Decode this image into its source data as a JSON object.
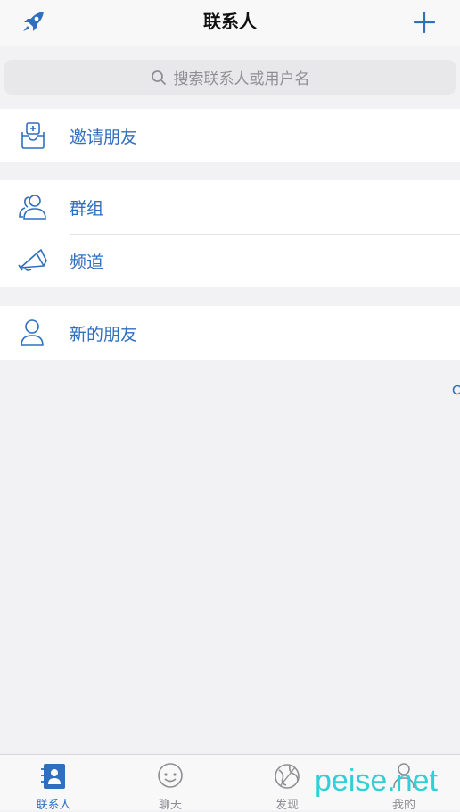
{
  "header": {
    "title": "联系人",
    "left_icon": "rocket-icon",
    "right_icon": "plus-icon"
  },
  "search": {
    "placeholder": "搜索联系人或用户名"
  },
  "sections": [
    {
      "items": [
        {
          "label": "邀请朋友",
          "icon": "invite-tray-icon"
        }
      ]
    },
    {
      "items": [
        {
          "label": "群组",
          "icon": "group-icon"
        },
        {
          "label": "频道",
          "icon": "megaphone-icon"
        }
      ]
    },
    {
      "items": [
        {
          "label": "新的朋友",
          "icon": "person-icon"
        }
      ]
    }
  ],
  "tabbar": {
    "tabs": [
      {
        "label": "联系人",
        "icon": "contacts-icon",
        "active": true
      },
      {
        "label": "聊天",
        "icon": "chat-icon",
        "active": false
      },
      {
        "label": "发现",
        "icon": "discover-icon",
        "active": false
      },
      {
        "label": "我的",
        "icon": "profile-icon",
        "active": false
      }
    ]
  },
  "watermark": {
    "text": "peise.net"
  },
  "colors": {
    "accent": "#2f6fbf",
    "background": "#f2f2f4",
    "watermark": "#2fd0d8"
  }
}
